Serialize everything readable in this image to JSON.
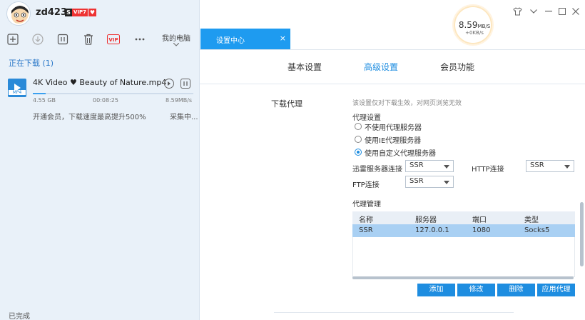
{
  "user": {
    "name": "zd423",
    "badge_s": "S",
    "badge_vip": "VIP7",
    "badge_flag": "♥"
  },
  "toolbar": {
    "my_computer_label": "我的电脑"
  },
  "speed_widget": {
    "main": "8.59",
    "main_unit": "MB/S",
    "sub": "+0KB/s"
  },
  "left": {
    "downloading_title": "正在下载 (1)",
    "item": {
      "filename": "4K Video ♥ Beauty of Nature.mp4",
      "file_type": "MP4",
      "size": "4.55 GB",
      "eta": "00:08:25",
      "speed": "8.59MB/s",
      "progress": 0.08,
      "promo": "开通会员，下载速度最高提升500%",
      "status": "采集中..."
    },
    "footer": "已完成"
  },
  "tab": {
    "title": "设置中心",
    "close": "×"
  },
  "settings_tabs": [
    "基本设置",
    "高级设置",
    "会员功能"
  ],
  "proxy": {
    "section_label": "下载代理",
    "hint": "该设置仅对下载生效，对网页浏览无效",
    "settings_heading": "代理设置",
    "options": [
      "不使用代理服务器",
      "使用IE代理服务器",
      "使用自定义代理服务器"
    ],
    "xunlei_label": "迅雷服务器连接",
    "xunlei_value": "SSR",
    "http_label": "HTTP连接",
    "http_value": "SSR",
    "ftp_label": "FTP连接",
    "ftp_value": "SSR",
    "manage_heading": "代理管理",
    "columns": [
      "名称",
      "服务器",
      "端口",
      "类型"
    ],
    "rows": [
      [
        "SSR",
        "127.0.0.1",
        "1080",
        "Socks5"
      ]
    ],
    "buttons": [
      "添加",
      "修改",
      "删除",
      "应用代理"
    ]
  },
  "colors": {
    "accent": "#1e8de0",
    "selected_row": "#a9d0f3",
    "left_bg": "#e9f1f9"
  }
}
